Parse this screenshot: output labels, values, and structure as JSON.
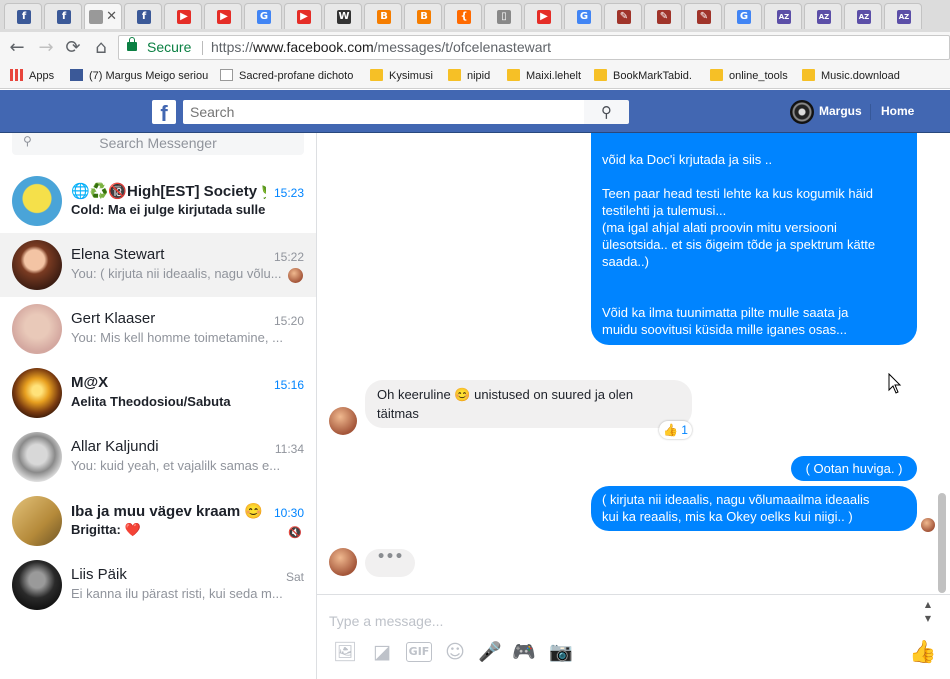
{
  "browser": {
    "tabs": [
      {
        "icon": "facebook-icon",
        "color": "#3b5998",
        "glyph": "f"
      },
      {
        "icon": "facebook-icon",
        "color": "#3b5998",
        "glyph": "f"
      },
      {
        "icon": "messenger-icon",
        "color": "#999999",
        "glyph": ""
      },
      {
        "icon": "facebook-icon",
        "color": "#3b5998",
        "glyph": "f"
      },
      {
        "icon": "youtube-icon",
        "color": "#e52d27",
        "glyph": "▶"
      },
      {
        "icon": "youtube-icon",
        "color": "#e52d27",
        "glyph": "▶"
      },
      {
        "icon": "google-icon",
        "color": "#4285f4",
        "glyph": "G"
      },
      {
        "icon": "youtube-icon",
        "color": "#e52d27",
        "glyph": "▶"
      },
      {
        "icon": "wikipedia-icon",
        "color": "#333333",
        "glyph": "W"
      },
      {
        "icon": "blogger-icon",
        "color": "#f57d00",
        "glyph": "B"
      },
      {
        "icon": "blogger-icon",
        "color": "#f57d00",
        "glyph": "B"
      },
      {
        "icon": "firefox-icon",
        "color": "#ff6a00",
        "glyph": "{"
      },
      {
        "icon": "page-icon",
        "color": "#888888",
        "glyph": "▯"
      },
      {
        "icon": "youtube-icon",
        "color": "#e52d27",
        "glyph": "▶"
      },
      {
        "icon": "google-icon",
        "color": "#4285f4",
        "glyph": "G"
      },
      {
        "icon": "bookmark-icon",
        "color": "#a0342a",
        "glyph": "✎"
      },
      {
        "icon": "bookmark-icon",
        "color": "#a0342a",
        "glyph": "✎"
      },
      {
        "icon": "bookmark-icon",
        "color": "#a0342a",
        "glyph": "✎"
      },
      {
        "icon": "google-icon",
        "color": "#4285f4",
        "glyph": "G"
      },
      {
        "icon": "az-icon",
        "color": "#5c4fa8",
        "glyph": "AZ"
      },
      {
        "icon": "az-icon",
        "color": "#5c4fa8",
        "glyph": "AZ"
      },
      {
        "icon": "az-icon",
        "color": "#5c4fa8",
        "glyph": "AZ"
      },
      {
        "icon": "az-icon",
        "color": "#5c4fa8",
        "glyph": "AZ"
      }
    ],
    "tab_close": "✕",
    "nav": {
      "back": "←",
      "forward": "→",
      "reload": "⟳",
      "home": "⌂"
    },
    "secure_label": "Secure",
    "url_prefix": "https://",
    "url_domain": "www.facebook.com",
    "url_path": "/messages/t/ofcelenastewart",
    "bookmarks": [
      {
        "label": "Apps",
        "icon": "apps-icon"
      },
      {
        "label": "(7) Margus Meigo seriou",
        "icon": "facebook-icon"
      },
      {
        "label": "Sacred-profane dichoto",
        "icon": "wikipedia-icon"
      },
      {
        "label": "Kysimusi",
        "icon": "folder-icon"
      },
      {
        "label": "nipid",
        "icon": "folder-icon"
      },
      {
        "label": "Maixi.lehelt",
        "icon": "folder-icon"
      },
      {
        "label": "BookMarkTabid.",
        "icon": "folder-icon"
      },
      {
        "label": "online_tools",
        "icon": "folder-icon"
      },
      {
        "label": "Music.download",
        "icon": "folder-icon"
      }
    ]
  },
  "facebook": {
    "logo": "f",
    "search_placeholder": "Search",
    "search_icon": "⚲",
    "profile_name": "Margus",
    "home_label": "Home"
  },
  "sidebar": {
    "search_placeholder": "Search Messenger",
    "conversations": [
      {
        "name": "🌐♻️🔞High[EST] Society 🌿",
        "snippet": "Cold: Ma ei julge kirjutada sulle",
        "time": "15:23",
        "unread": true,
        "avatar": "spongebob-avatar"
      },
      {
        "name": "Elena Stewart",
        "snippet": "You: ( kirjuta nii ideaalis, nagu võlu...",
        "time": "15:22",
        "unread": false,
        "selected": true,
        "avatar": "elena-avatar",
        "seen": true
      },
      {
        "name": "Gert Klaaser",
        "snippet": "You: Mis kell homme toimetamine, ...",
        "time": "15:20",
        "unread": false,
        "avatar": "gert-avatar"
      },
      {
        "name": "M@X",
        "snippet": "Aelita Theodosiou/Sabuta",
        "time": "15:16",
        "unread": true,
        "avatar": "max-avatar"
      },
      {
        "name": "Allar Kaljundi",
        "snippet": "You: kuid yeah, et vajalilk samas e...",
        "time": "11:34",
        "unread": false,
        "avatar": "allar-avatar"
      },
      {
        "name": "Iba ja muu vägev kraam 😊",
        "snippet": "Brigitta: ❤️",
        "time": "10:30",
        "unread": true,
        "avatar": "iba-avatar",
        "muted": true
      },
      {
        "name": "Liis Päik",
        "snippet": "Ei kanna ilu pärast risti, kui seda m...",
        "time": "Sat",
        "unread": false,
        "avatar": "liis-avatar"
      }
    ]
  },
  "chat": {
    "big_bubble_lines": [
      "võid ka Doc'i krjutada ja siis ..",
      "",
      "Teen paar head testi lehte ka kus kogumik häid",
      "testilehti ja tulemusi...",
      "(ma igal ahjal alati proovin mitu versiooni",
      "ülesotsida.. et sis õigeim tõde ja spektrum kätte",
      "saada..)",
      "",
      "",
      "Võid ka ilma tuunimatta pilte mulle saata ja",
      "muidu soovitusi küsida mille iganes osas..."
    ],
    "incoming_lines": [
      "Oh keeruline 😊 unistused on suured ja olen",
      "täitmas"
    ],
    "reaction_emoji": "👍",
    "reaction_count": "1",
    "outgoing_short": "( Ootan huviga. )",
    "outgoing_lines": [
      "(  kirjuta nii ideaalis, nagu võlumaailma ideaalis",
      "kui ka reaalis, mis ka Okey oelks kui niigi..  )"
    ],
    "typing_indicator": "•••"
  },
  "composer": {
    "placeholder": "Type a message...",
    "icons": [
      "photo-icon",
      "sticker-icon",
      "gif-icon",
      "emoji-icon",
      "microphone-icon",
      "game-icon",
      "camera-icon"
    ],
    "glyphs": [
      "🖼",
      "◪",
      "GIF",
      "☺",
      "🎤",
      "🎮",
      "📷"
    ],
    "like_glyph": "👍"
  }
}
